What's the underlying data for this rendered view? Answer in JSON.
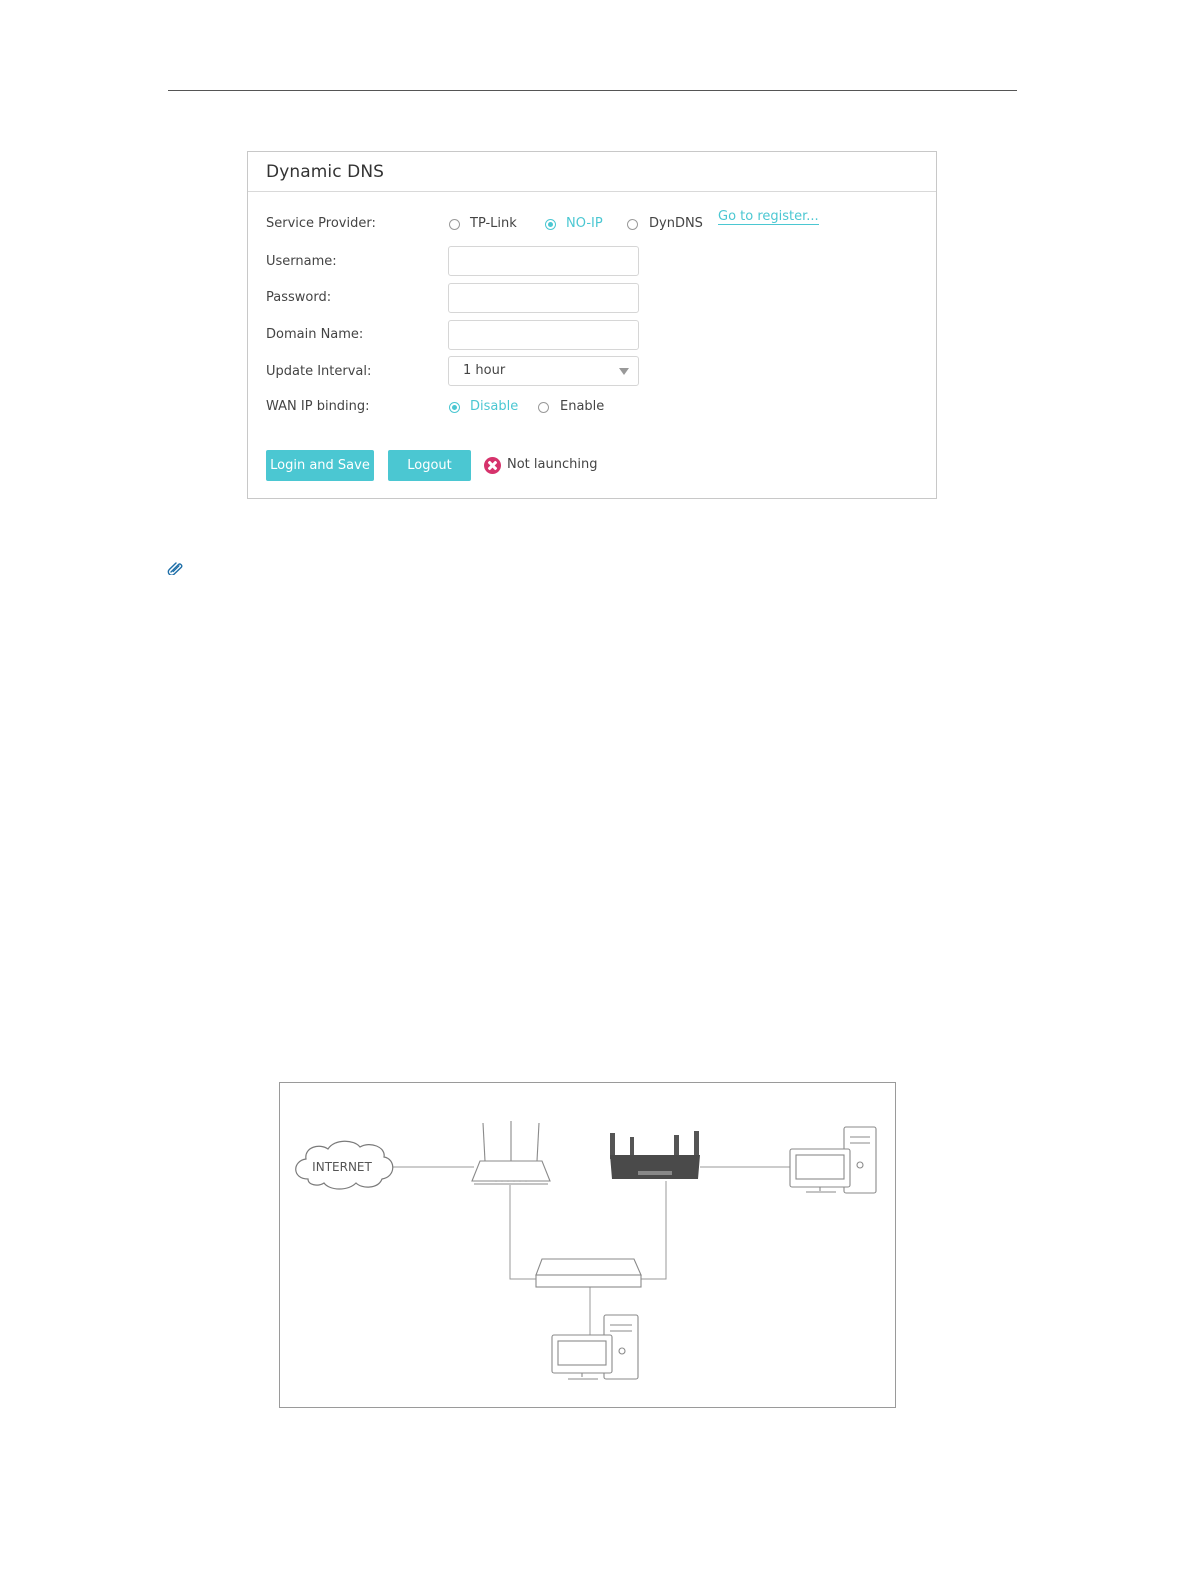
{
  "panel": {
    "title": "Dynamic DNS",
    "labels": {
      "service_provider": "Service Provider:",
      "username": "Username:",
      "password": "Password:",
      "domain_name": "Domain Name:",
      "update_interval": "Update Interval:",
      "wan_ip_binding": "WAN IP binding:"
    },
    "service_provider": {
      "options": [
        "TP-Link",
        "NO-IP",
        "DynDNS"
      ],
      "selected": "NO-IP",
      "register_link": "Go to register..."
    },
    "fields": {
      "username": {
        "value": "",
        "placeholder": ""
      },
      "password": {
        "value": "",
        "placeholder": ""
      },
      "domain_name": {
        "value": "",
        "placeholder": ""
      }
    },
    "update_interval": {
      "selected": "1 hour"
    },
    "wan_ip_binding": {
      "options": [
        "Disable",
        "Enable"
      ],
      "selected": "Disable"
    },
    "buttons": {
      "login_save": "Login and Save",
      "logout": "Logout"
    },
    "status": {
      "text": "Not launching",
      "icon": "error-x-icon",
      "color": "#d6336c"
    },
    "accent_color": "#4bc7d2"
  },
  "note": {
    "icon": "paperclip-icon"
  },
  "diagram": {
    "internet_label": "INTERNET"
  }
}
